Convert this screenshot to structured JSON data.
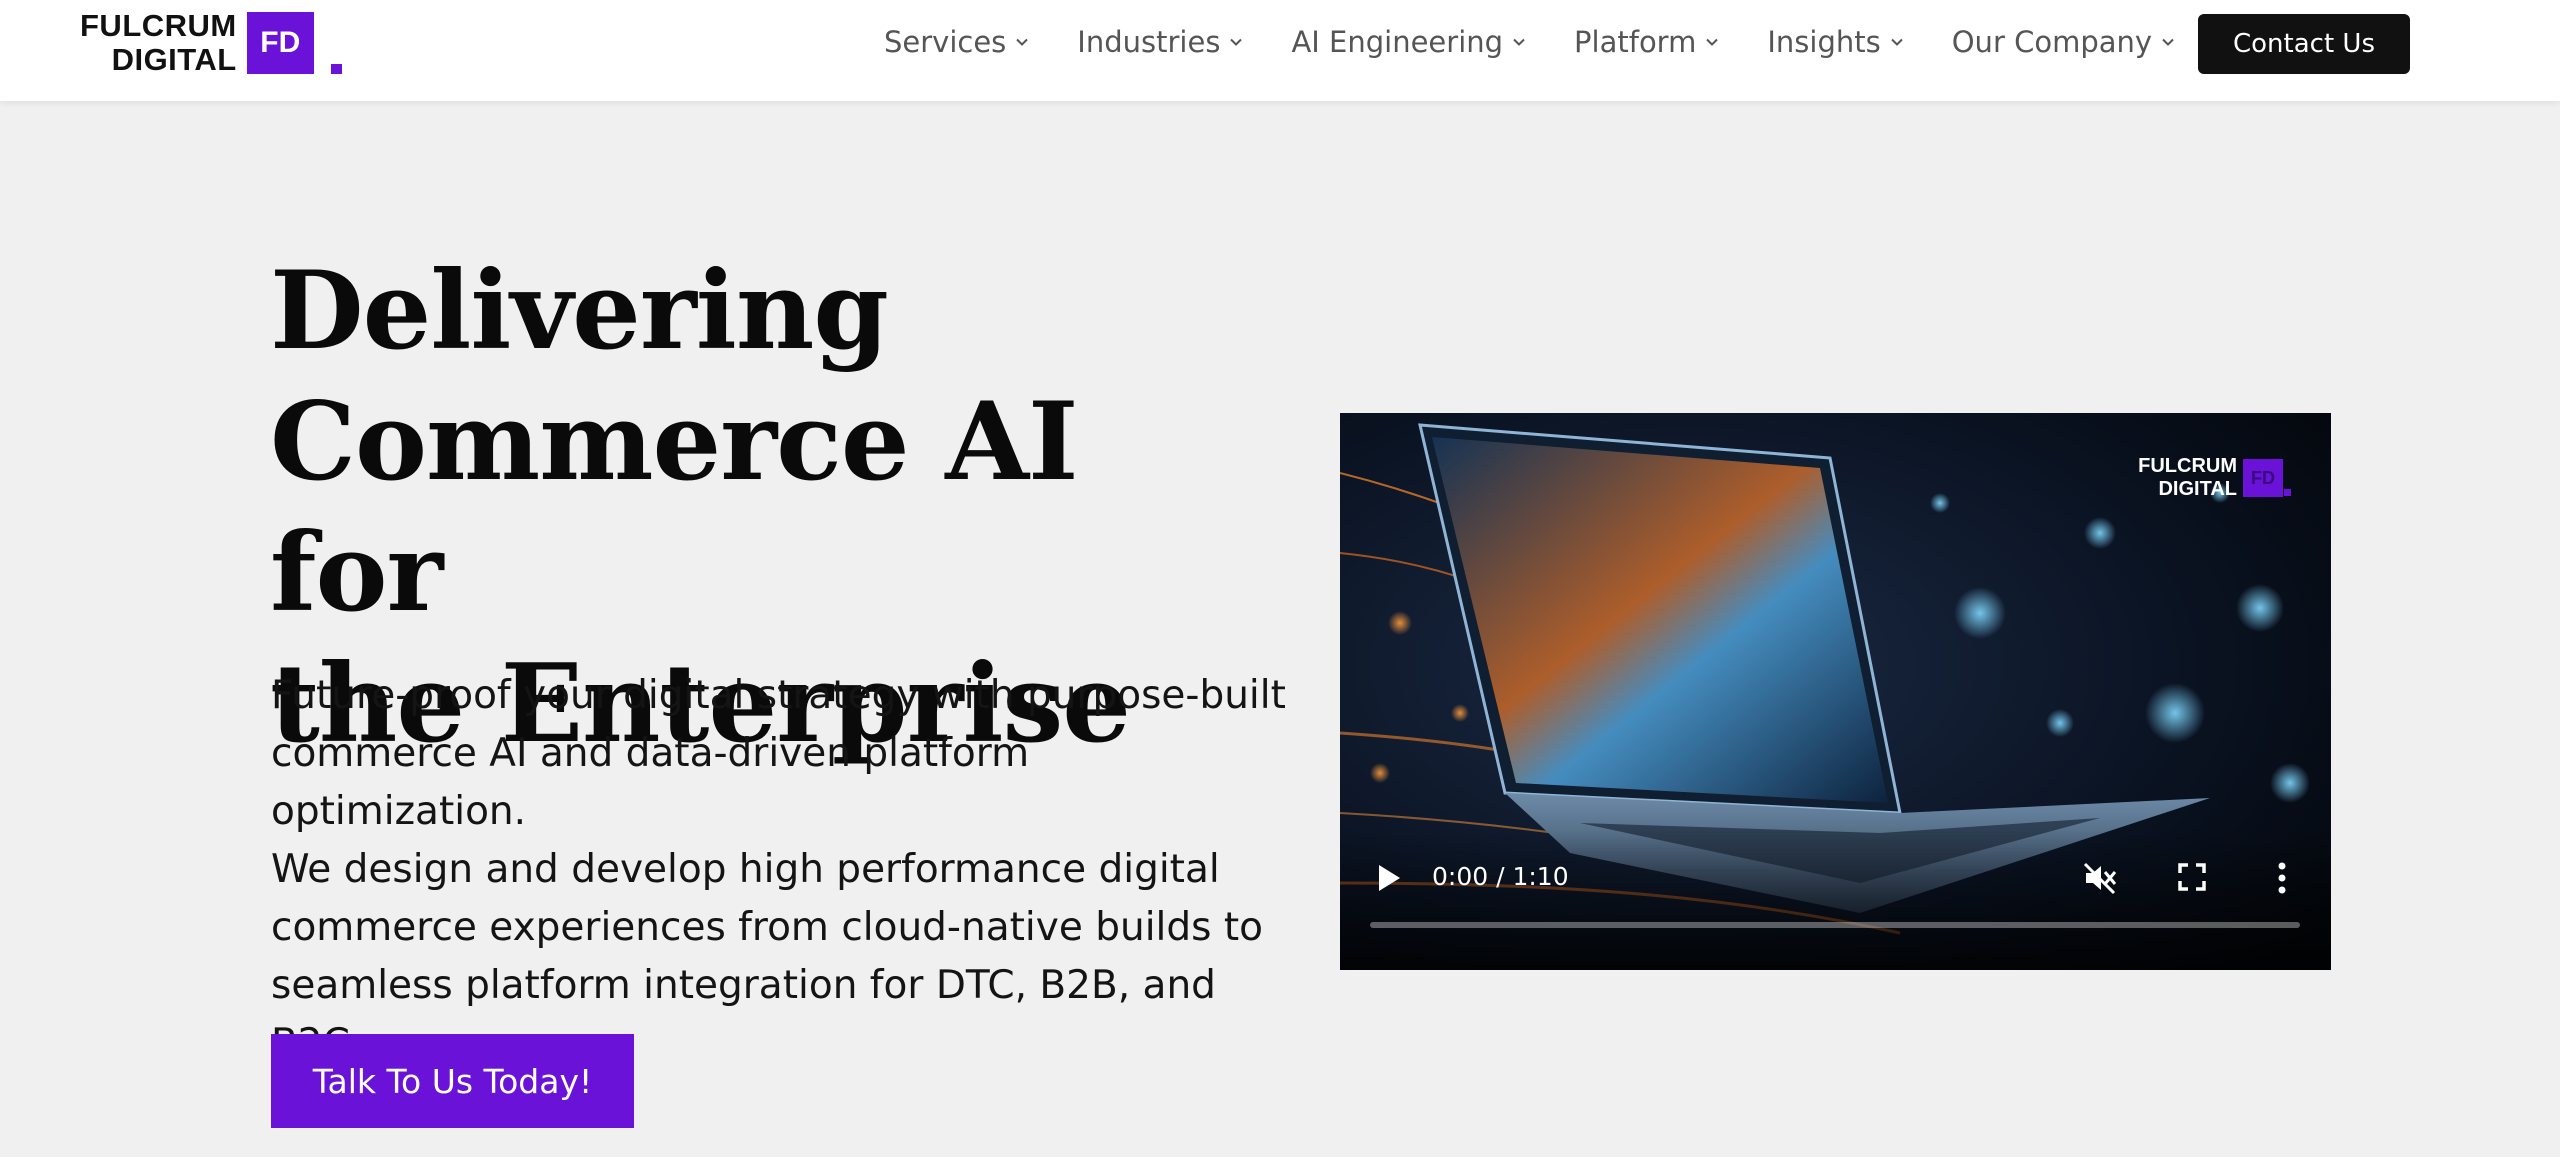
{
  "header": {
    "logo": {
      "line1": "FULCRUM",
      "line2": "DIGITAL",
      "mark": "FD"
    },
    "nav": [
      {
        "label": "Services",
        "icon": "chevron-down-icon"
      },
      {
        "label": "Industries",
        "icon": "chevron-down-icon"
      },
      {
        "label": "AI Engineering",
        "icon": "chevron-down-icon"
      },
      {
        "label": "Platform",
        "icon": "chevron-down-icon"
      },
      {
        "label": "Insights",
        "icon": "chevron-down-icon"
      },
      {
        "label": "Our Company",
        "icon": "chevron-down-icon"
      }
    ],
    "contact_label": "Contact Us"
  },
  "hero": {
    "title_lines": [
      "Delivering",
      "Commerce AI for",
      "the Enterprise"
    ],
    "description_lines": [
      "Future-proof your digital strategy with purpose-built",
      "commerce AI and data-driven platform optimization.",
      "We design and develop high performance digital",
      "commerce experiences from cloud-native builds to",
      "seamless platform integration for DTC, B2B, and",
      "B2C."
    ],
    "cta_label": "Talk To Us Today!"
  },
  "video": {
    "logo": {
      "line1": "FULCRUM",
      "line2": "DIGITAL",
      "mark": "FD"
    },
    "time": "0:00 / 1:10",
    "progress": 0,
    "muted": true,
    "icons": [
      "play-icon",
      "muted-icon",
      "fullscreen-icon",
      "more-vert-icon"
    ]
  },
  "colors": {
    "brand": "#6a12d8",
    "background": "#f0f0f0",
    "header_bg": "#ffffff",
    "contact_bg": "#111111",
    "nav_text": "#555555"
  }
}
